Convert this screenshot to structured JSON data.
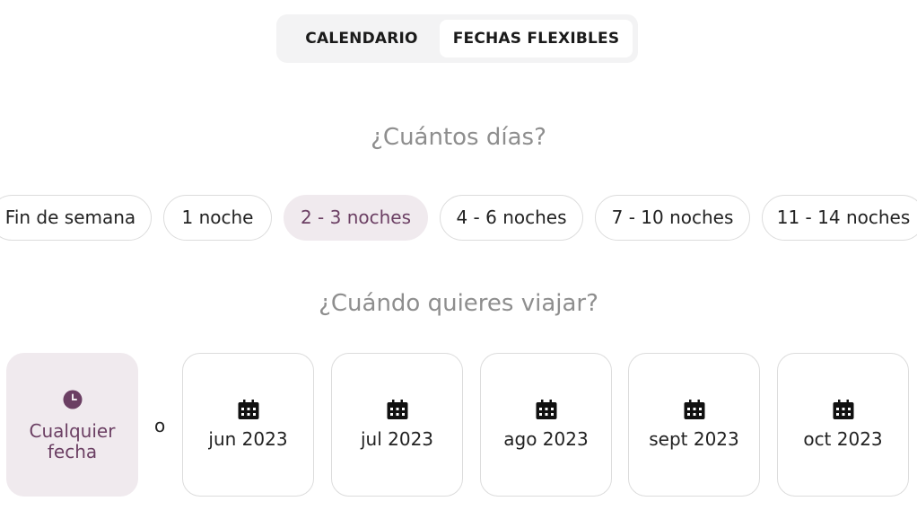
{
  "toggle": {
    "calendar_label": "CALENDARIO",
    "flexible_label": "FECHAS FLEXIBLES",
    "active": "flexible"
  },
  "duration": {
    "heading": "¿Cuántos días?",
    "options": [
      "Fin de semana",
      "1 noche",
      "2 - 3 noches",
      "4 - 6 noches",
      "7 - 10 noches",
      "11 - 14 noches"
    ],
    "selected": "2 - 3 noches"
  },
  "when": {
    "heading": "¿Cuándo quieres viajar?",
    "any_label_line1": "Cualquier",
    "any_label_line2": "fecha",
    "separator": "o",
    "months": [
      "jun 2023",
      "jul 2023",
      "ago 2023",
      "sept 2023",
      "oct 2023"
    ]
  },
  "colors": {
    "accent": "#6b3f63",
    "selected_bg": "#f0eaee",
    "heading_gray": "#8e8e8e"
  }
}
